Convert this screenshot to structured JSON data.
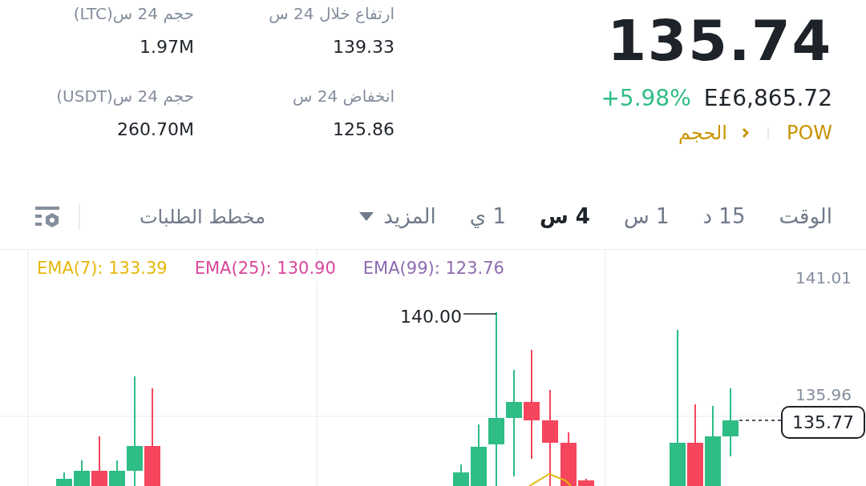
{
  "ticker": {
    "price": "135.74",
    "change": "+5.98%",
    "fiat_price": "E£6,865.72",
    "tags": [
      {
        "label": "POW",
        "kind": "tag"
      },
      {
        "label": "الحجم",
        "kind": "link"
      }
    ]
  },
  "stats": [
    {
      "label": "ارتفاع خلال 24 س",
      "value": "139.33"
    },
    {
      "label": "حجم 24 س(LTC)",
      "value": "1.97M"
    },
    {
      "label": "انخفاض 24 س",
      "value": "125.86"
    },
    {
      "label": "حجم 24 س(USDT)",
      "value": "260.70M"
    }
  ],
  "intervals": [
    {
      "label": "الوقت",
      "selected": false
    },
    {
      "label": "15 د",
      "selected": false
    },
    {
      "label": "1 س",
      "selected": false
    },
    {
      "label": "4 س",
      "selected": true
    },
    {
      "label": "1 ي",
      "selected": false
    },
    {
      "label": "المزيد",
      "selected": false,
      "kind": "dropdown"
    }
  ],
  "depth_tab": {
    "label": "مخطط الطلبات"
  },
  "chart": {
    "legend": [
      {
        "label": "EMA(99): 123.76",
        "color": "#8e6bb0"
      },
      {
        "label": "EMA(25): 130.90",
        "color": "#d9479b"
      },
      {
        "label": "EMA(7): 133.39",
        "color": "#e5b80b"
      }
    ],
    "axis_labels": [
      "141.01",
      "135.96"
    ],
    "high_marker": "140.00",
    "last_price": "135.77"
  }
}
